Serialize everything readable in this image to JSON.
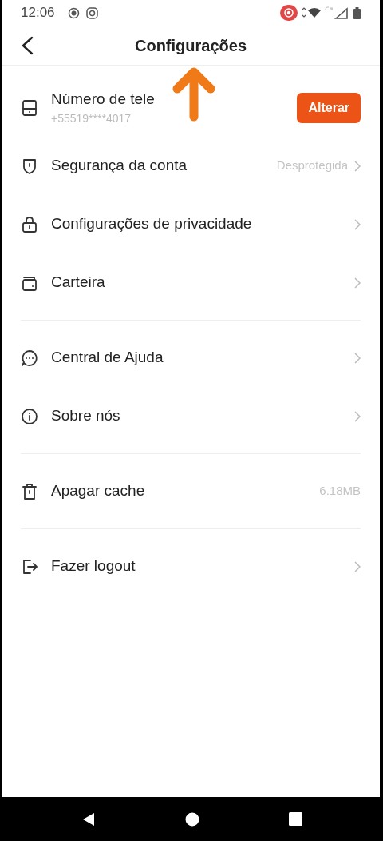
{
  "status_bar": {
    "time": "12:06"
  },
  "header": {
    "title": "Configurações"
  },
  "groups": [
    {
      "items": [
        {
          "kind": "phone",
          "label": "Número de tele",
          "sublabel": "+55519****4017",
          "button": "Alterar",
          "chevron": false
        },
        {
          "kind": "shield",
          "label": "Segurança da conta",
          "value": "Desprotegida",
          "chevron": true
        },
        {
          "kind": "lock",
          "label": "Configurações de privacidade",
          "chevron": true
        },
        {
          "kind": "wallet",
          "label": "Carteira",
          "chevron": true
        }
      ]
    },
    {
      "items": [
        {
          "kind": "chat",
          "label": "Central de Ajuda",
          "chevron": true
        },
        {
          "kind": "info",
          "label": "Sobre nós",
          "chevron": true
        }
      ]
    },
    {
      "items": [
        {
          "kind": "trash",
          "label": "Apagar cache",
          "value": "6.18MB",
          "chevron": false
        }
      ]
    },
    {
      "items": [
        {
          "kind": "logout",
          "label": "Fazer logout",
          "chevron": true
        }
      ]
    }
  ]
}
